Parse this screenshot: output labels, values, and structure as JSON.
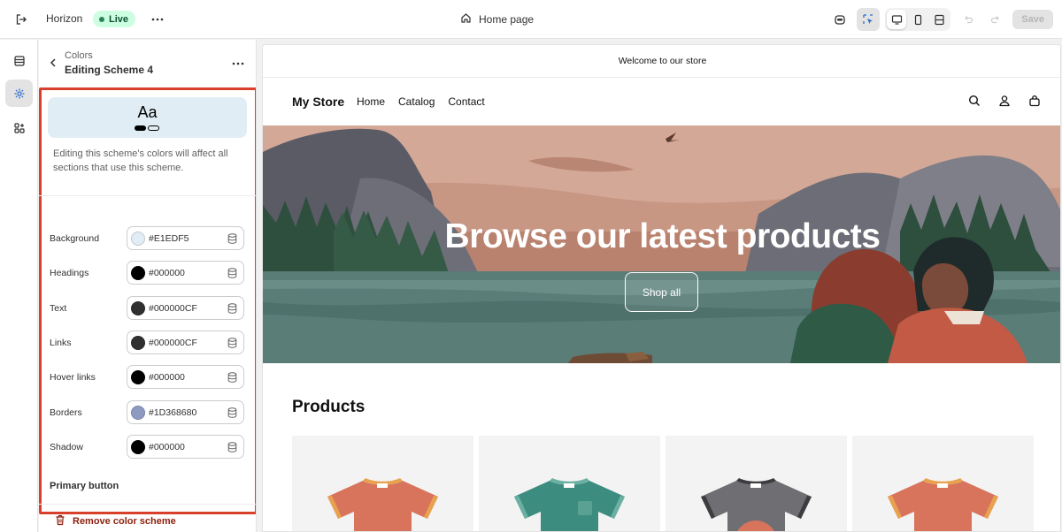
{
  "topbar": {
    "theme_name": "Horizon",
    "live_badge": "Live",
    "page_selector": "Home page",
    "save_label": "Save"
  },
  "panel": {
    "breadcrumb": "Colors",
    "title": "Editing Scheme 4",
    "preview_text": "Aa",
    "description": "Editing this scheme's colors will affect all sections that use this scheme.",
    "colors": [
      {
        "label": "Background",
        "value": "#E1EDF5",
        "swatch": "#e1edf5"
      },
      {
        "label": "Headings",
        "value": "#000000",
        "swatch": "#000000"
      },
      {
        "label": "Text",
        "value": "#000000CF",
        "swatch": "#303030"
      },
      {
        "label": "Links",
        "value": "#000000CF",
        "swatch": "#303030"
      },
      {
        "label": "Hover links",
        "value": "#000000",
        "swatch": "#000000"
      },
      {
        "label": "Borders",
        "value": "#1D368680",
        "swatch": "#8e9ac2"
      },
      {
        "label": "Shadow",
        "value": "#000000",
        "swatch": "#000000"
      }
    ],
    "primary_button_label": "Primary button",
    "remove_label": "Remove color scheme"
  },
  "store": {
    "announcement": "Welcome to our store",
    "logo": "My Store",
    "nav": [
      "Home",
      "Catalog",
      "Contact"
    ],
    "hero_title": "Browse our latest products",
    "hero_button": "Shop all",
    "products_title": "Products"
  }
}
